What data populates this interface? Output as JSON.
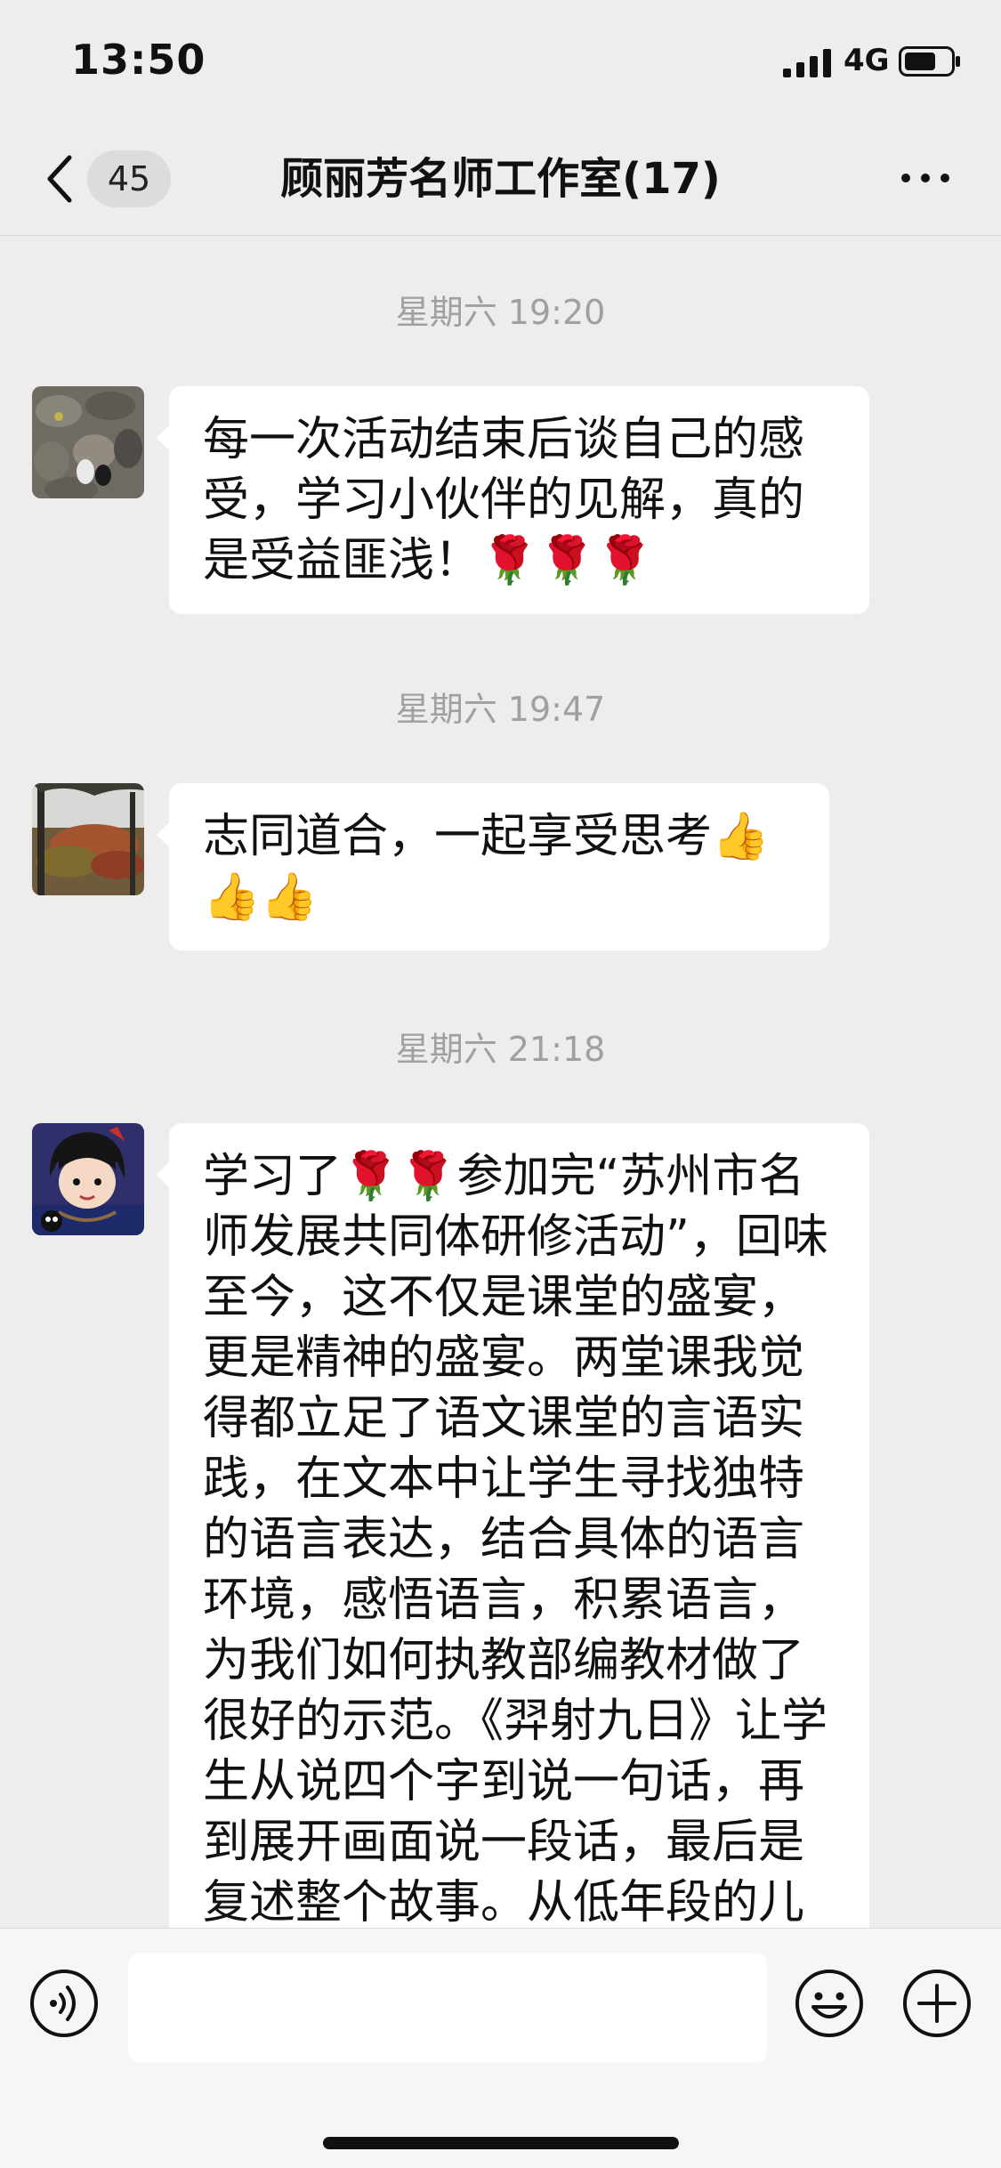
{
  "status": {
    "time": "13:50",
    "network": "4G"
  },
  "nav": {
    "badge": "45",
    "title": "顾丽芳名师工作室(17)"
  },
  "messages": [
    {
      "timestamp": "星期六 19:20",
      "text": "每一次活动结束后谈自己的感受，学习小伙伴的见解，真的是受益匪浅！🌹🌹🌹",
      "avatar": "stone-path-avatar"
    },
    {
      "timestamp": "星期六 19:47",
      "text": "志同道合，一起享受思考👍👍👍",
      "avatar": "autumn-trees-avatar"
    },
    {
      "timestamp": "星期六 21:18",
      "text": "学习了🌹🌹参加完“苏州市名师发展共同体研修活动”，回味至今，这不仅是课堂的盛宴，更是精神的盛宴。两堂课我觉得都立足了语文课堂的言语实践，在文本中让学生寻找独特的语言表达，结合具体的语言环境，感悟语言，积累语言，为我们如何执教部编教材做了很好的示范。《羿射九日》让学生从说四个字到说一句话，再到展开画面说一段话，最后是复述整个故事。从低年段的儿童视野出发，找到",
      "avatar": "cartoon-girl-avatar"
    }
  ],
  "input": {
    "placeholder": ""
  },
  "colors": {
    "background": "#ededed",
    "bubble": "#ffffff",
    "timestamp": "#a0a0a0"
  }
}
